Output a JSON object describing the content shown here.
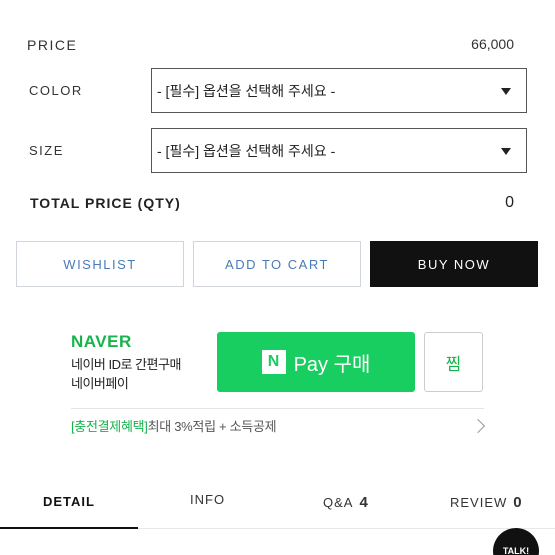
{
  "price": {
    "label": "PRICE",
    "value": "66,000"
  },
  "color": {
    "label": "COLOR",
    "selected": "- [필수] 옵션을 선택해 주세요 -"
  },
  "size": {
    "label": "SIZE",
    "selected": "- [필수] 옵션을 선택해 주세요 -"
  },
  "total": {
    "label": "TOTAL PRICE (QTY)",
    "value": "0"
  },
  "buttons": {
    "wishlist": "WISHLIST",
    "add_to_cart": "ADD TO CART",
    "buy_now": "BUY NOW"
  },
  "naver": {
    "logo": "NAVER",
    "desc_line1": "네이버 ID로 간편구매",
    "desc_line2": "네이버페이",
    "npay_n": "N",
    "npay_label": "Pay 구매",
    "jjim": "찜",
    "benefit_highlight": "[충전결제혜택]",
    "benefit_text": "최대 3%적립 + 소득공제"
  },
  "tabs": [
    {
      "label": "DETAIL",
      "count": ""
    },
    {
      "label": "INFO",
      "count": ""
    },
    {
      "label": "Q&A",
      "count": "4"
    },
    {
      "label": "REVIEW",
      "count": "0"
    }
  ],
  "talk": "TALK!",
  "colors": {
    "naver_green": "#19ce60",
    "link_blue": "#4a7bb8",
    "dark": "#111111"
  }
}
